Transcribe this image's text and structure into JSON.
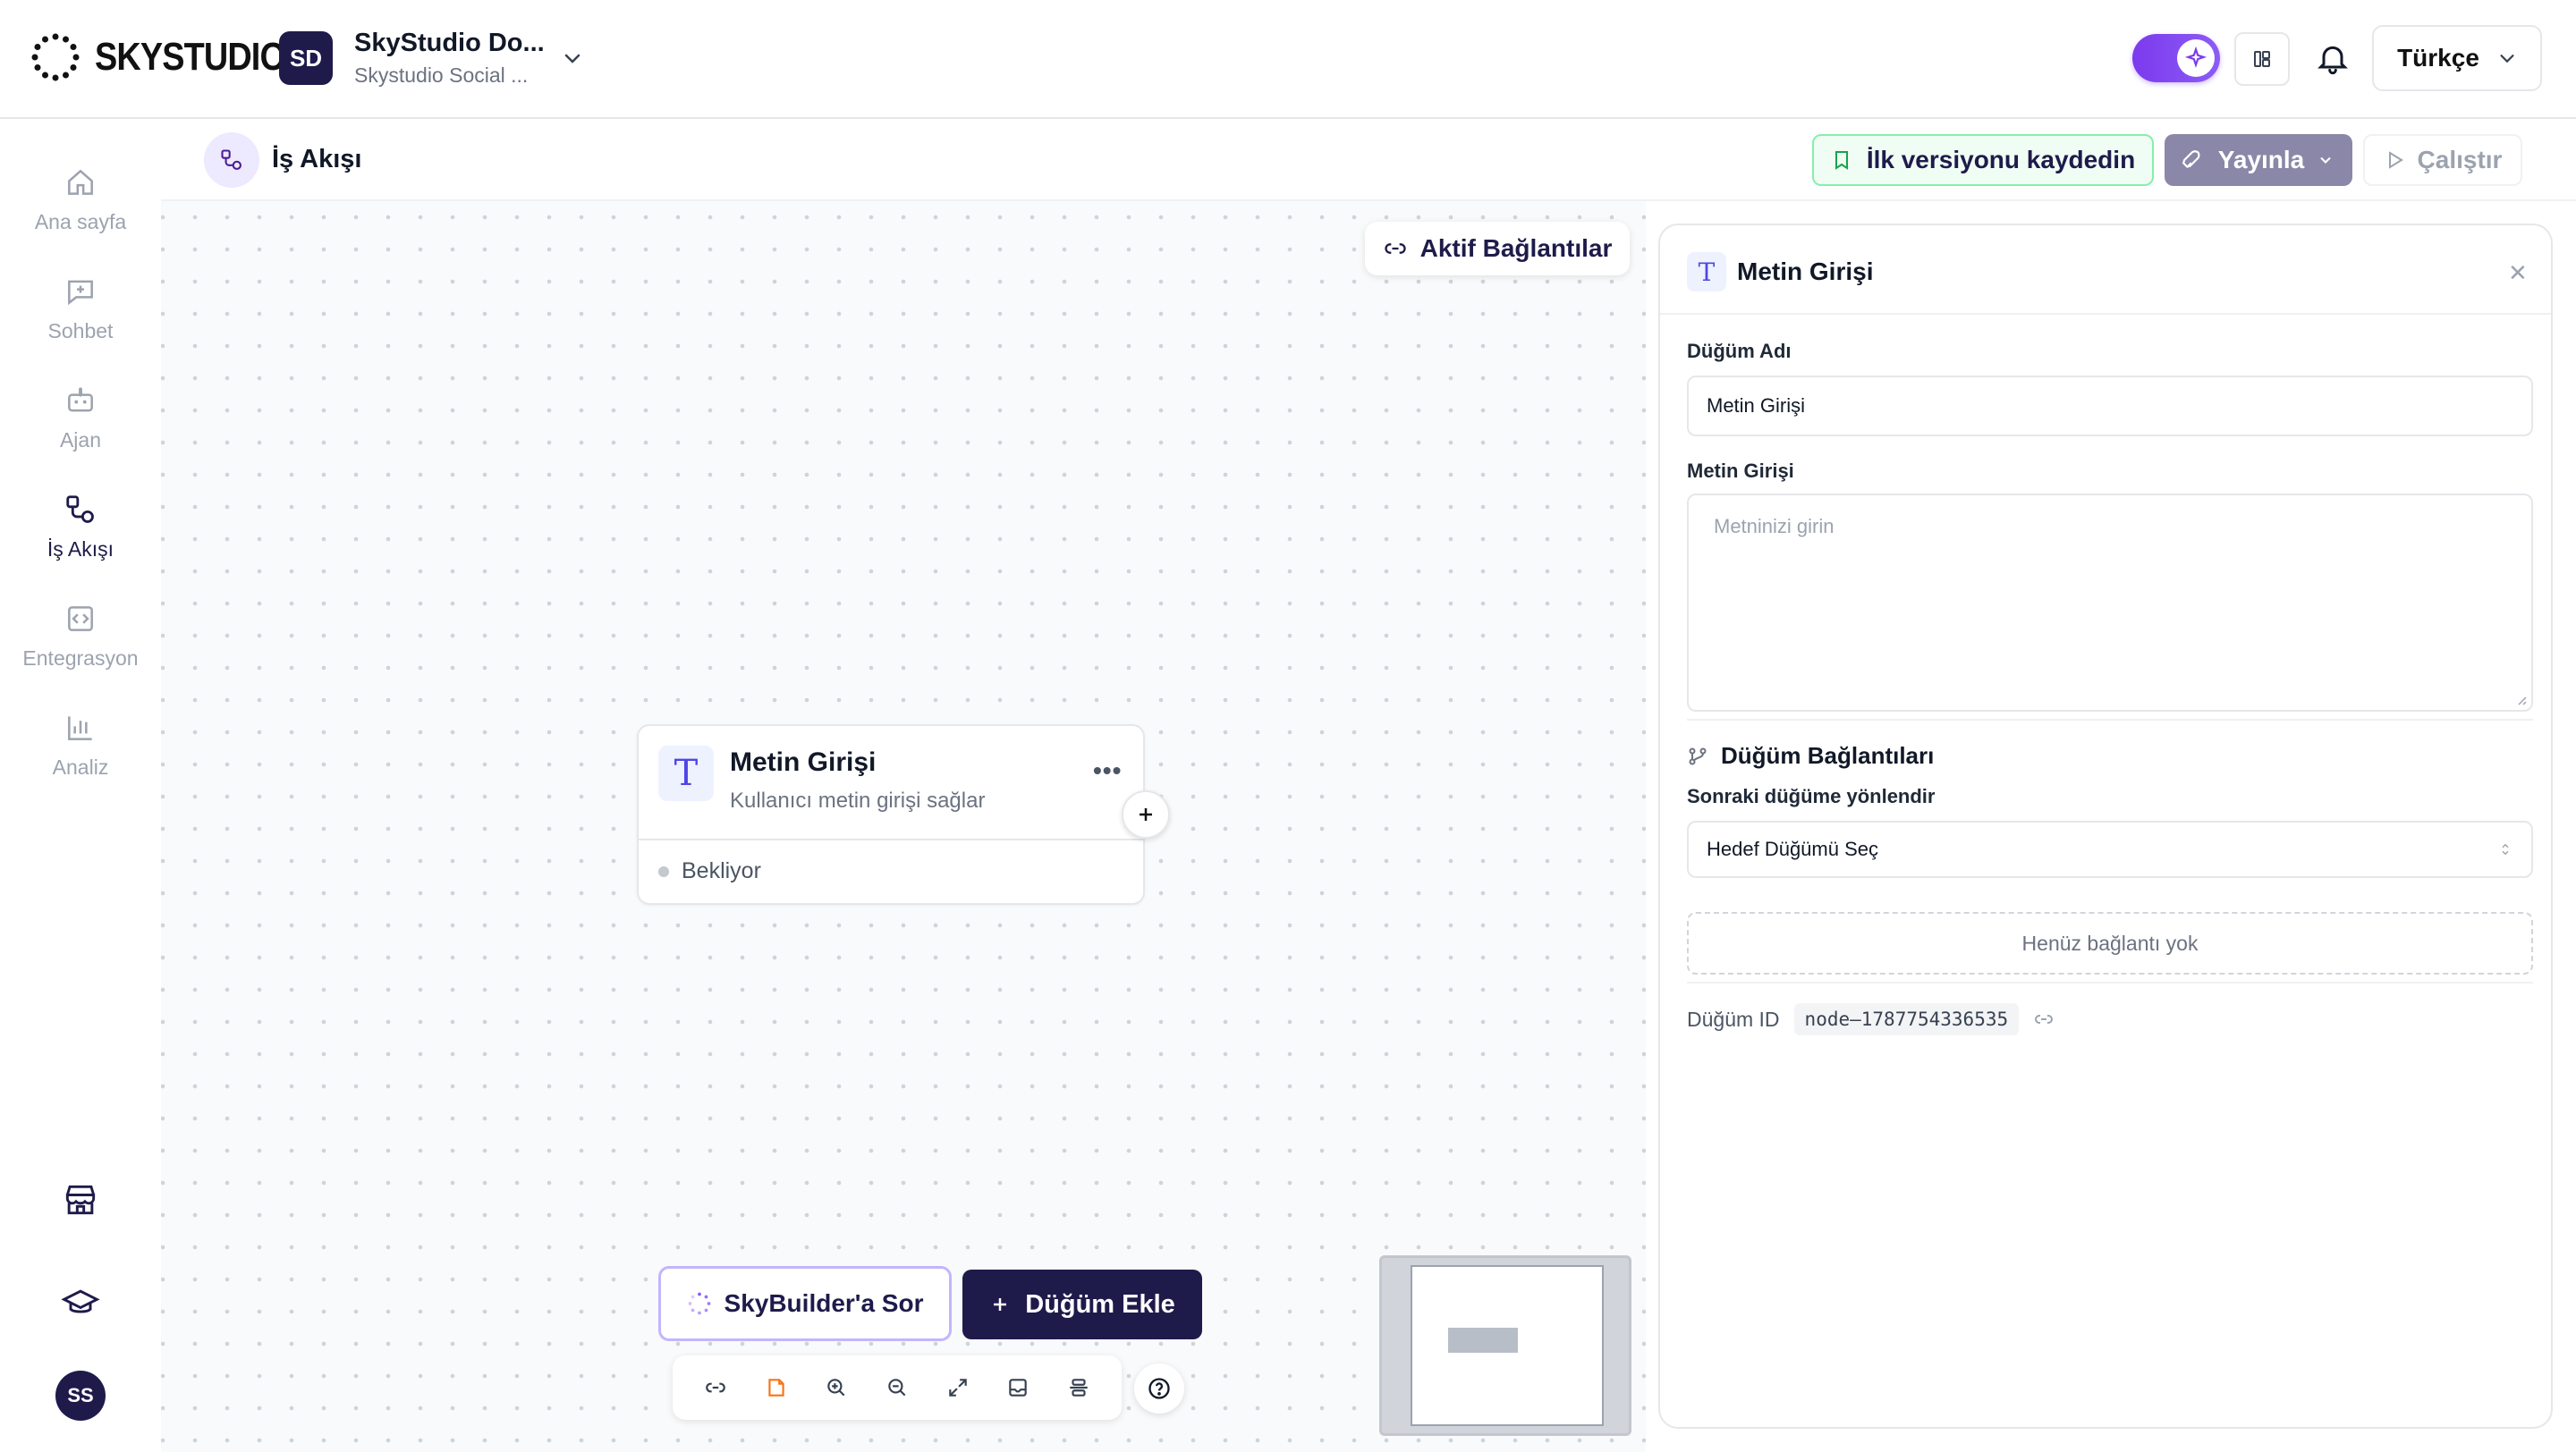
{
  "brand": {
    "name": "SKYSTUDIO"
  },
  "workspace": {
    "initials": "SD",
    "name": "SkyStudio Do...",
    "subtitle": "Skystudio Social ..."
  },
  "header": {
    "language": "Türkçe"
  },
  "sidebar": {
    "items": [
      {
        "label": "Ana sayfa",
        "icon": "home-icon"
      },
      {
        "label": "Sohbet",
        "icon": "chat-plus-icon"
      },
      {
        "label": "Ajan",
        "icon": "bot-icon"
      },
      {
        "label": "İş Akışı",
        "icon": "workflow-icon",
        "active": true
      },
      {
        "label": "Entegrasyon",
        "icon": "code-icon"
      },
      {
        "label": "Analiz",
        "icon": "bar-chart-icon"
      }
    ],
    "bottom_icons": [
      "store-icon",
      "graduation-cap-icon"
    ],
    "user_initials": "SS"
  },
  "subheader": {
    "title": "İş Akışı",
    "save_label": "İlk versiyonu kaydedin",
    "publish_label": "Yayınla",
    "run_label": "Çalıştır"
  },
  "canvas": {
    "active_connections_label": "Aktif Bağlantılar",
    "node": {
      "title": "Metin Girişi",
      "subtitle": "Kullanıcı metin girişi sağlar",
      "status": "Bekliyor",
      "icon_glyph": "T"
    },
    "ask_label": "SkyBuilder'a Sor",
    "add_node_label": "Düğüm Ekle"
  },
  "panel": {
    "title": "Metin Girişi",
    "node_name_label": "Düğüm Adı",
    "node_name_value": "Metin Girişi",
    "text_input_label": "Metin Girişi",
    "text_input_placeholder": "Metninizi girin",
    "connections_title": "Düğüm Bağlantıları",
    "redirect_label": "Sonraki düğüme yönlendir",
    "target_select": "Hedef Düğümü Seç",
    "no_connections": "Henüz bağlantı yok",
    "node_id_label": "Düğüm ID",
    "node_id_value": "node–1787754336535"
  },
  "colors": {
    "brand": "#1e1b4b",
    "accent": "#8b5cf6",
    "save_border": "#86efac",
    "publish_bg": "#8b87a8"
  }
}
